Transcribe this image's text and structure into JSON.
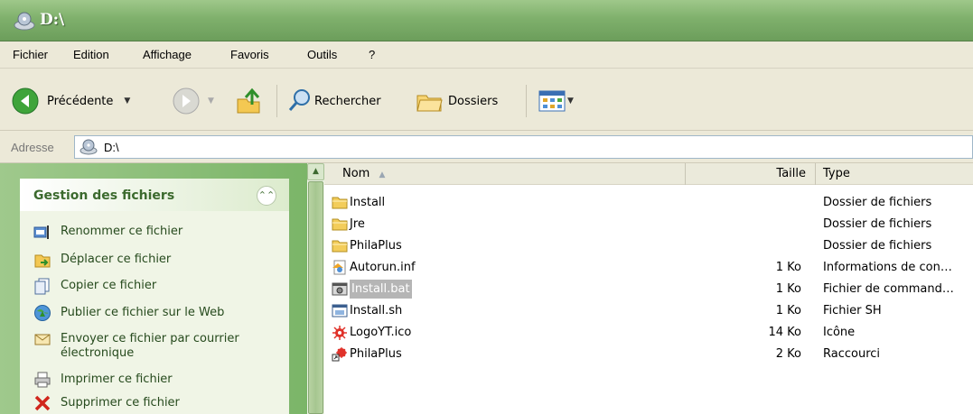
{
  "window": {
    "title": "D:\\"
  },
  "menu": {
    "items": [
      "Fichier",
      "Edition",
      "Affichage",
      "Favoris",
      "Outils",
      "?"
    ]
  },
  "toolbar": {
    "back_label": "Précédente",
    "search_label": "Rechercher",
    "folders_label": "Dossiers"
  },
  "address": {
    "label": "Adresse",
    "value": "D:\\"
  },
  "taskpane": {
    "title": "Gestion des fichiers",
    "tasks": [
      {
        "label": "Renommer ce fichier",
        "icon": "rename-icon"
      },
      {
        "label": "Déplacer ce fichier",
        "icon": "move-icon"
      },
      {
        "label": "Copier ce fichier",
        "icon": "copy-icon"
      },
      {
        "label": "Publier ce fichier sur le Web",
        "icon": "publish-web-icon"
      },
      {
        "label": "Envoyer ce fichier par courrier électronique",
        "icon": "email-icon"
      },
      {
        "label": "Imprimer ce fichier",
        "icon": "print-icon"
      },
      {
        "label": "Supprimer ce fichier",
        "icon": "delete-icon"
      }
    ]
  },
  "filelist": {
    "columns": {
      "name": "Nom",
      "size": "Taille",
      "type": "Type"
    },
    "files": [
      {
        "name": "Install",
        "size": "",
        "type": "Dossier de fichiers",
        "icon": "folder-icon",
        "selected": false
      },
      {
        "name": "Jre",
        "size": "",
        "type": "Dossier de fichiers",
        "icon": "folder-icon",
        "selected": false
      },
      {
        "name": "PhilaPlus",
        "size": "",
        "type": "Dossier de fichiers",
        "icon": "folder-icon",
        "selected": false
      },
      {
        "name": "Autorun.inf",
        "size": "1 Ko",
        "type": "Informations de con…",
        "icon": "inf-file-icon",
        "selected": false
      },
      {
        "name": "Install.bat",
        "size": "1 Ko",
        "type": "Fichier de command…",
        "icon": "bat-file-icon",
        "selected": true
      },
      {
        "name": "Install.sh",
        "size": "1 Ko",
        "type": "Fichier SH",
        "icon": "sh-file-icon",
        "selected": false
      },
      {
        "name": "LogoYT.ico",
        "size": "14 Ko",
        "type": "Icône",
        "icon": "ico-file-icon",
        "selected": false
      },
      {
        "name": "PhilaPlus",
        "size": "2 Ko",
        "type": "Raccourci",
        "icon": "shortcut-icon",
        "selected": false
      }
    ]
  }
}
